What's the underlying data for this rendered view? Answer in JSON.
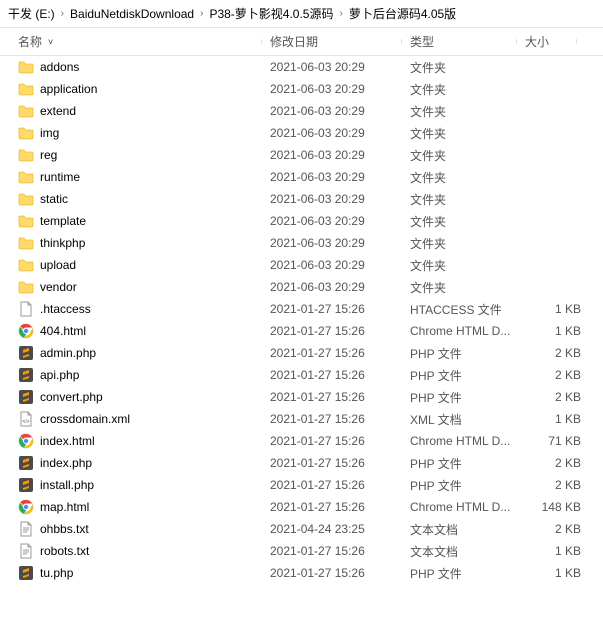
{
  "breadcrumb": [
    "干发 (E:)",
    "BaiduNetdiskDownload",
    "P38-萝卜影视4.0.5源码",
    "萝卜后台源码4.05版"
  ],
  "columns": {
    "name": "名称",
    "date": "修改日期",
    "type": "类型",
    "size": "大小"
  },
  "files": [
    {
      "icon": "folder",
      "name": "addons",
      "date": "2021-06-03 20:29",
      "type": "文件夹",
      "size": ""
    },
    {
      "icon": "folder",
      "name": "application",
      "date": "2021-06-03 20:29",
      "type": "文件夹",
      "size": ""
    },
    {
      "icon": "folder",
      "name": "extend",
      "date": "2021-06-03 20:29",
      "type": "文件夹",
      "size": ""
    },
    {
      "icon": "folder",
      "name": "img",
      "date": "2021-06-03 20:29",
      "type": "文件夹",
      "size": ""
    },
    {
      "icon": "folder",
      "name": "reg",
      "date": "2021-06-03 20:29",
      "type": "文件夹",
      "size": ""
    },
    {
      "icon": "folder",
      "name": "runtime",
      "date": "2021-06-03 20:29",
      "type": "文件夹",
      "size": ""
    },
    {
      "icon": "folder",
      "name": "static",
      "date": "2021-06-03 20:29",
      "type": "文件夹",
      "size": ""
    },
    {
      "icon": "folder",
      "name": "template",
      "date": "2021-06-03 20:29",
      "type": "文件夹",
      "size": ""
    },
    {
      "icon": "folder",
      "name": "thinkphp",
      "date": "2021-06-03 20:29",
      "type": "文件夹",
      "size": ""
    },
    {
      "icon": "folder",
      "name": "upload",
      "date": "2021-06-03 20:29",
      "type": "文件夹",
      "size": ""
    },
    {
      "icon": "folder",
      "name": "vendor",
      "date": "2021-06-03 20:29",
      "type": "文件夹",
      "size": ""
    },
    {
      "icon": "file",
      "name": ".htaccess",
      "date": "2021-01-27 15:26",
      "type": "HTACCESS 文件",
      "size": "1 KB"
    },
    {
      "icon": "chrome",
      "name": "404.html",
      "date": "2021-01-27 15:26",
      "type": "Chrome HTML D...",
      "size": "1 KB"
    },
    {
      "icon": "sublime",
      "name": "admin.php",
      "date": "2021-01-27 15:26",
      "type": "PHP 文件",
      "size": "2 KB"
    },
    {
      "icon": "sublime",
      "name": "api.php",
      "date": "2021-01-27 15:26",
      "type": "PHP 文件",
      "size": "2 KB"
    },
    {
      "icon": "sublime",
      "name": "convert.php",
      "date": "2021-01-27 15:26",
      "type": "PHP 文件",
      "size": "2 KB"
    },
    {
      "icon": "xml",
      "name": "crossdomain.xml",
      "date": "2021-01-27 15:26",
      "type": "XML 文档",
      "size": "1 KB"
    },
    {
      "icon": "chrome",
      "name": "index.html",
      "date": "2021-01-27 15:26",
      "type": "Chrome HTML D...",
      "size": "71 KB"
    },
    {
      "icon": "sublime",
      "name": "index.php",
      "date": "2021-01-27 15:26",
      "type": "PHP 文件",
      "size": "2 KB"
    },
    {
      "icon": "sublime",
      "name": "install.php",
      "date": "2021-01-27 15:26",
      "type": "PHP 文件",
      "size": "2 KB"
    },
    {
      "icon": "chrome",
      "name": "map.html",
      "date": "2021-01-27 15:26",
      "type": "Chrome HTML D...",
      "size": "148 KB"
    },
    {
      "icon": "text",
      "name": "ohbbs.txt",
      "date": "2021-04-24 23:25",
      "type": "文本文档",
      "size": "2 KB"
    },
    {
      "icon": "text",
      "name": "robots.txt",
      "date": "2021-01-27 15:26",
      "type": "文本文档",
      "size": "1 KB"
    },
    {
      "icon": "sublime",
      "name": "tu.php",
      "date": "2021-01-27 15:26",
      "type": "PHP 文件",
      "size": "1 KB"
    }
  ]
}
